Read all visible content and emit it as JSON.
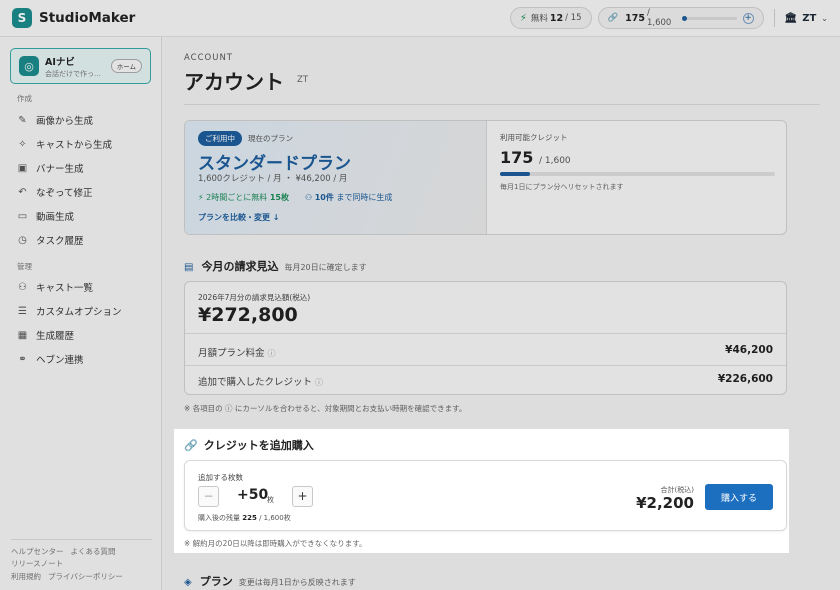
{
  "header": {
    "logo_letter": "S",
    "app_name": "StudioMaker",
    "free_label": "無料",
    "free_used": "12",
    "free_total": "/ 15",
    "credits_used": "175",
    "credits_total": "/ 1,600",
    "credit_fill": 0.109,
    "user": "ZT"
  },
  "sidebar": {
    "ai_title": "AIナビ",
    "ai_sub": "会話だけで作っ…",
    "ai_home": "ホーム",
    "section_create": "作成",
    "create_items": [
      {
        "label": "画像から生成",
        "icon": "brush-icon"
      },
      {
        "label": "キャストから生成",
        "icon": "sparkle-icon"
      },
      {
        "label": "バナー生成",
        "icon": "image-icon"
      },
      {
        "label": "なぞって修正",
        "icon": "trace-icon"
      },
      {
        "label": "動画生成",
        "icon": "video-icon"
      },
      {
        "label": "タスク履歴",
        "icon": "clock-icon"
      }
    ],
    "section_manage": "管理",
    "manage_items": [
      {
        "label": "キャスト一覧",
        "icon": "users-icon"
      },
      {
        "label": "カスタムオプション",
        "icon": "sliders-icon"
      },
      {
        "label": "生成履歴",
        "icon": "grid-icon"
      },
      {
        "label": "ヘブン連携",
        "icon": "link-icon"
      }
    ],
    "footer": {
      "help": "ヘルプセンター",
      "faq": "よくある質問",
      "release": "リリースノート",
      "terms": "利用規約",
      "privacy": "プライバシーポリシー"
    }
  },
  "page": {
    "label": "ACCOUNT",
    "title": "アカウント",
    "sub": "ZT"
  },
  "plan": {
    "badge": "ご利用中",
    "current": "現在のプラン",
    "name": "スタンダードプラン",
    "price": "1,600クレジット / 月 ・ ¥46,200 / 月",
    "feat_free_pre": "2時間ごとに無料",
    "feat_free_val": "15枚",
    "feat_para_val": "10件",
    "feat_para_post": "まで同時に生成",
    "compare": "プランを比較・変更 ↓",
    "credit_label": "利用可能クレジット",
    "credit_val": "175",
    "credit_total": "/ 1,600",
    "credit_note": "毎月1日にプラン分へリセットされます",
    "credit_fill": 0.109
  },
  "billing": {
    "title": "今月の請求見込",
    "sub": "毎月20日に確定します",
    "amount_label": "2026年7月分の請求見込額(税込)",
    "amount": "¥272,800",
    "row1_label": "月額プラン料金",
    "row1_val": "¥46,200",
    "row2_label": "追加で購入したクレジット",
    "row2_val": "¥226,600",
    "note": "※ 各項目の ⓘ にカーソルを合わせると、対象期間とお支払い時期を確認できます。"
  },
  "purchase": {
    "title": "クレジットを追加購入",
    "qty_label": "追加する枚数",
    "qty_val": "+50",
    "qty_unit": "枚",
    "remain_pre": "購入後の残量",
    "remain_val": "225",
    "remain_total": "/ 1,600枚",
    "total_label": "合計(税込)",
    "total_val": "¥2,200",
    "buy": "購入する",
    "note": "※ 解約月の20日以降は即時購入ができなくなります。"
  },
  "plan_section": {
    "title": "プラン",
    "sub": "変更は毎月1日から反映されます"
  },
  "colors": {
    "accent": "#1c5c9a",
    "brand": "#1a8a8a",
    "button": "#1c6fbf"
  }
}
